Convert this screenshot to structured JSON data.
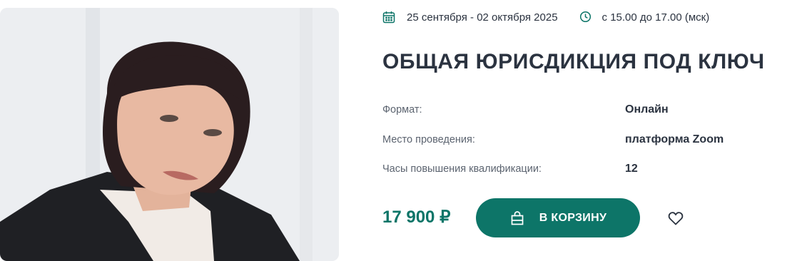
{
  "event": {
    "dates": "25 сентября - 02 октября 2025",
    "time": "с 15.00 до 17.00 (мск)",
    "title": "ОБЩАЯ ЮРИСДИКЦИЯ ПОД КЛЮЧ",
    "details": [
      {
        "label": "Формат:",
        "value": "Онлайн"
      },
      {
        "label": "Место проведения:",
        "value": "платформа Zoom"
      },
      {
        "label": "Часы повышения квалификации:",
        "value": "12"
      }
    ],
    "price": "17 900 ₽",
    "cart_label": "В КОРЗИНУ"
  },
  "icons": {
    "calendar": "calendar-icon",
    "clock": "clock-icon",
    "bag": "shopping-bag-icon",
    "heart": "heart-icon"
  },
  "colors": {
    "accent": "#0d7568",
    "text": "#2b3340",
    "muted": "#5c6470"
  }
}
